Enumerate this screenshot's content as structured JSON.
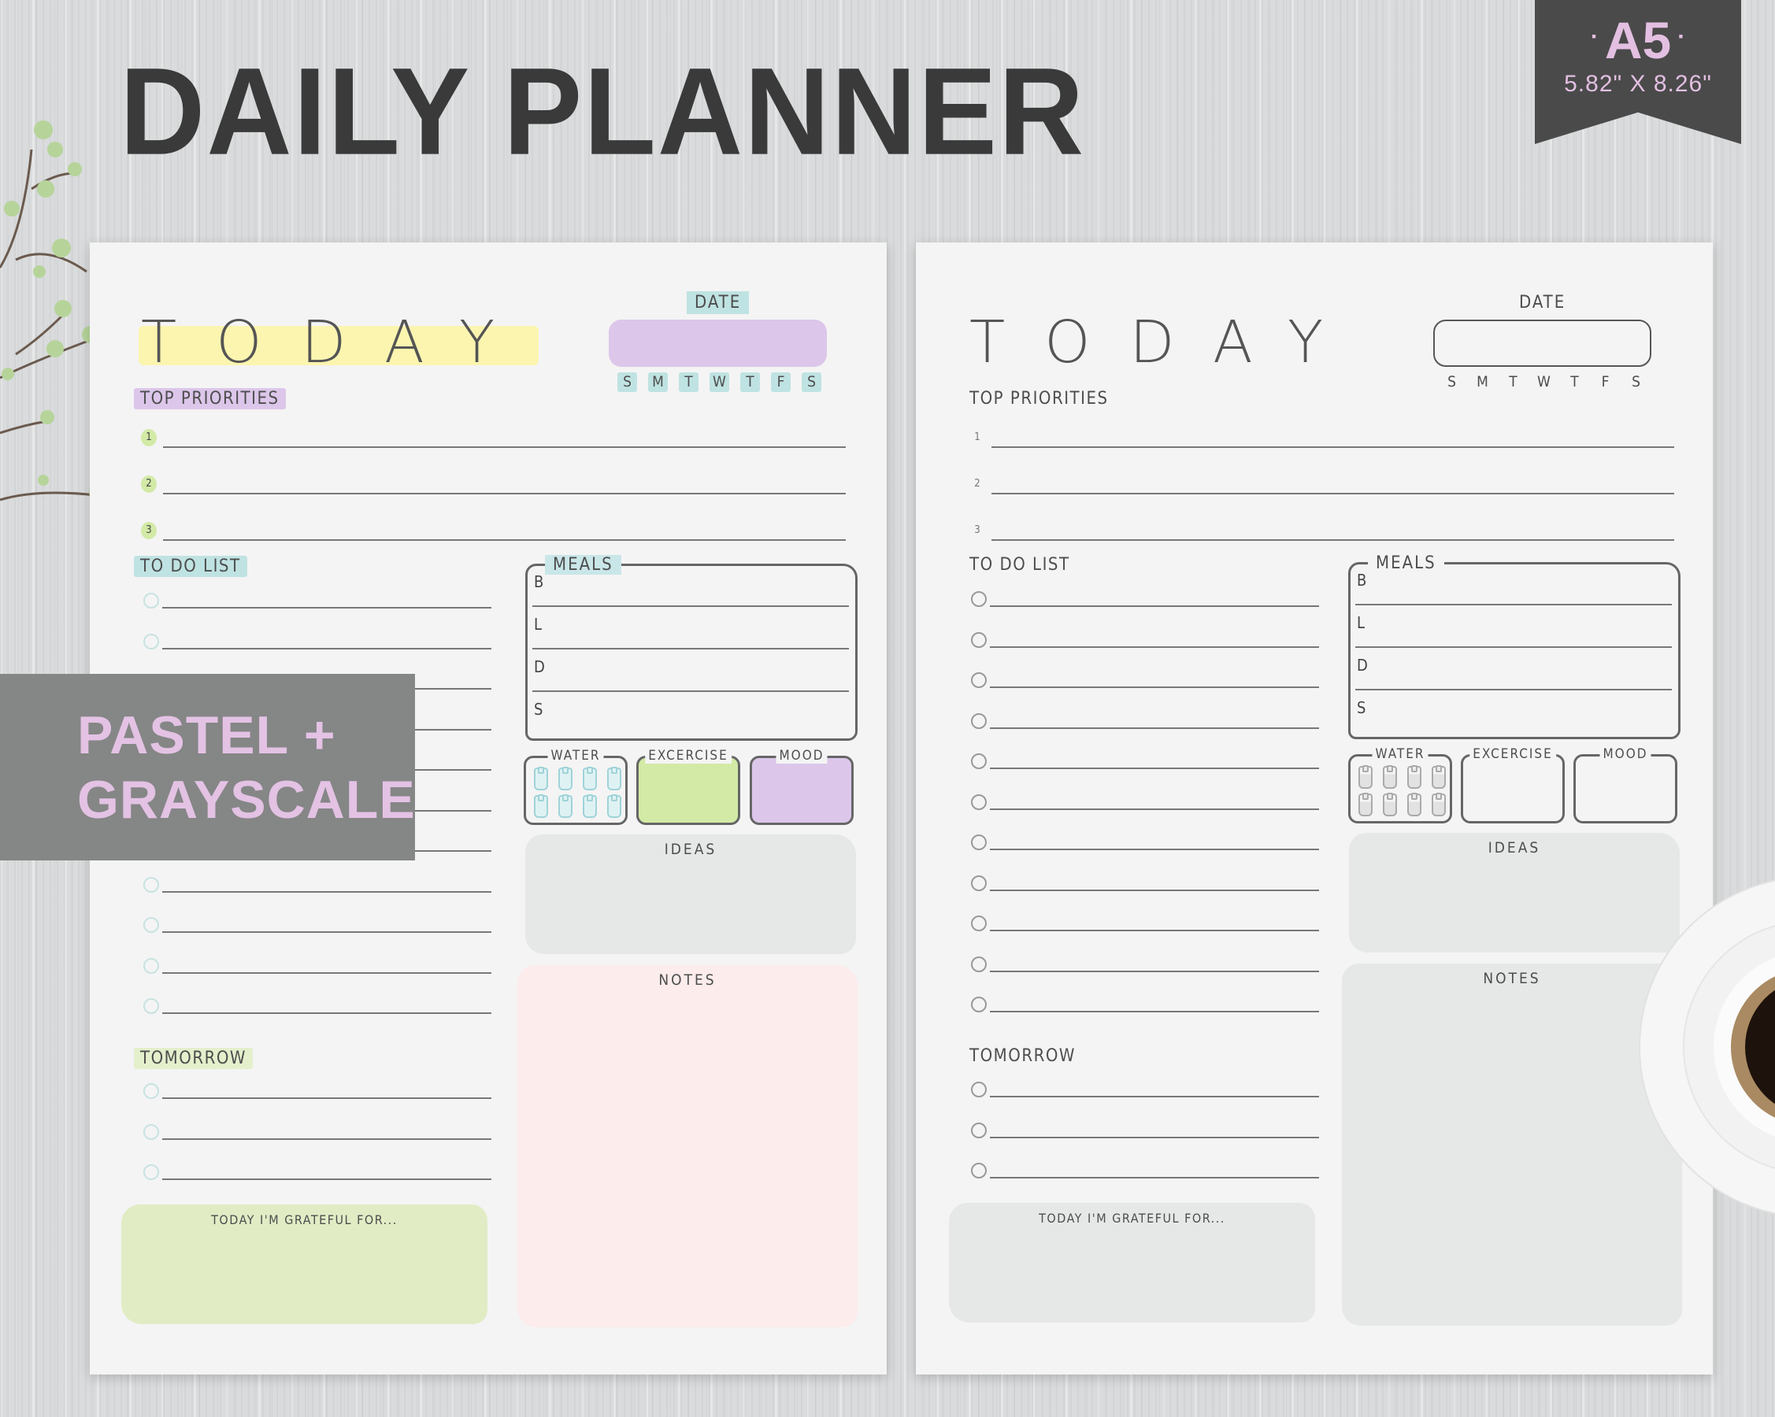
{
  "header": {
    "title": "DAILY PLANNER",
    "badge_size": "A5",
    "badge_dot": "·",
    "badge_dimensions": "5.82\" X 8.26\""
  },
  "overlay": {
    "line1": "PASTEL +",
    "line2": "GRAYSCALE"
  },
  "planner": {
    "today": "TODAY",
    "date_label": "DATE",
    "weekdays": [
      "S",
      "M",
      "T",
      "W",
      "T",
      "F",
      "S"
    ],
    "top_priorities_label": "TOP PRIORITIES",
    "priorities": [
      "1",
      "2",
      "3"
    ],
    "todo_label": "TO DO LIST",
    "todo_count": 11,
    "meals_label": "MEALS",
    "meals": [
      "B",
      "L",
      "D",
      "S"
    ],
    "water_label": "WATER",
    "water_glasses": 8,
    "exercise_label": "EXCERCISE",
    "mood_label": "MOOD",
    "ideas_label": "IDEAS",
    "notes_label": "NOTES",
    "tomorrow_label": "TOMORROW",
    "tomorrow_count": 3,
    "grateful_label": "TODAY I'M GRATEFUL FOR..."
  },
  "themes": {
    "pastel": {
      "name": "pastel",
      "yellow": "#fbf5b0",
      "teal": "#bfe3e2",
      "lavender": "#dcc6ea",
      "green": "#d2eaa6",
      "pink": "#fcecec",
      "gray": "#e6e7e7",
      "grateful": "#e1ecc5"
    },
    "grayscale": {
      "name": "grayscale",
      "box": "#e6e7e7"
    }
  }
}
